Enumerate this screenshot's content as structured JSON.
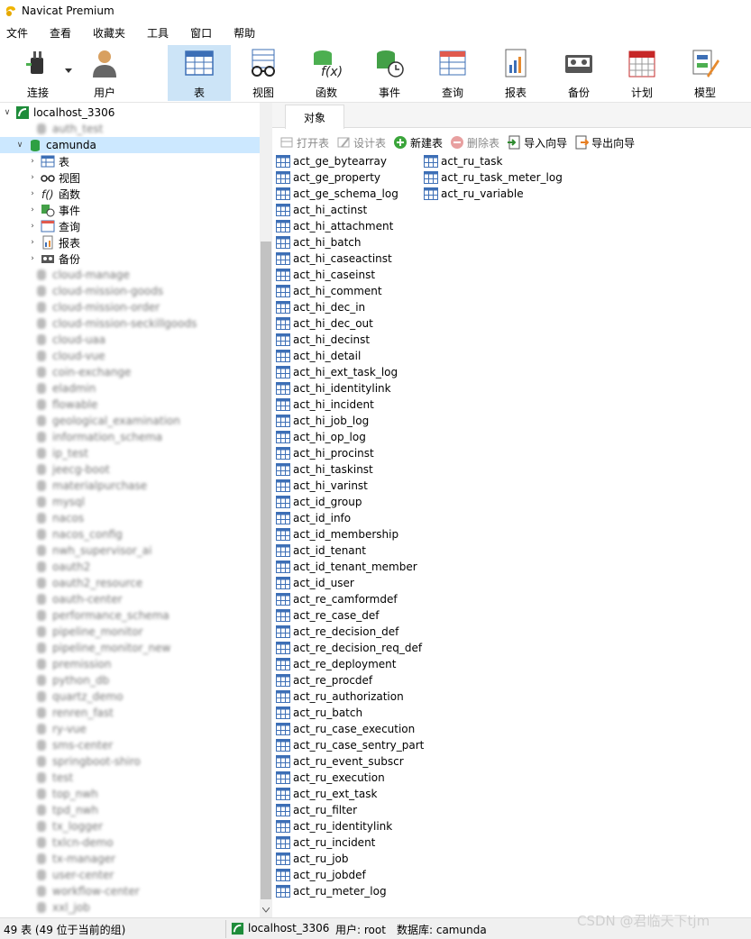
{
  "window": {
    "title": "Navicat Premium"
  },
  "menu": [
    "文件",
    "查看",
    "收藏夹",
    "工具",
    "窗口",
    "帮助"
  ],
  "toolbar": {
    "connect": "连接",
    "user": "用户",
    "table": "表",
    "view": "视图",
    "function": "函数",
    "event": "事件",
    "query": "查询",
    "report": "报表",
    "backup": "备份",
    "schedule": "计划",
    "model": "模型"
  },
  "tree": {
    "connection": "localhost_3306",
    "partial_db": "auth_test",
    "open_db": "camunda",
    "db_children": [
      "表",
      "视图",
      "函数",
      "事件",
      "查询",
      "报表",
      "备份"
    ],
    "other_dbs": [
      "cloud-manage",
      "cloud-mission-goods",
      "cloud-mission-order",
      "cloud-mission-seckillgoods",
      "cloud-uaa",
      "cloud-vue",
      "coin-exchange",
      "eladmin",
      "flowable",
      "geological_examination",
      "information_schema",
      "ip_test",
      "jeecg-boot",
      "materialpurchase",
      "mysql",
      "nacos",
      "nacos_config",
      "nwh_supervisor_ai",
      "oauth2",
      "oauth2_resource",
      "oauth-center",
      "performance_schema",
      "pipeline_monitor",
      "pipeline_monitor_new",
      "premission",
      "python_db",
      "quartz_demo",
      "renren_fast",
      "ry-vue",
      "sms-center",
      "springboot-shiro",
      "test",
      "top_nwh",
      "tpd_nwh",
      "tx_logger",
      "txlcn-demo",
      "tx-manager",
      "user-center",
      "workflow-center",
      "xxl_job"
    ]
  },
  "tabs": {
    "objects": "对象"
  },
  "object_toolbar": {
    "open_table": "打开表",
    "design_table": "设计表",
    "new_table": "新建表",
    "delete_table": "删除表",
    "import_wizard": "导入向导",
    "export_wizard": "导出向导"
  },
  "tables": [
    "act_ge_bytearray",
    "act_ge_property",
    "act_ge_schema_log",
    "act_hi_actinst",
    "act_hi_attachment",
    "act_hi_batch",
    "act_hi_caseactinst",
    "act_hi_caseinst",
    "act_hi_comment",
    "act_hi_dec_in",
    "act_hi_dec_out",
    "act_hi_decinst",
    "act_hi_detail",
    "act_hi_ext_task_log",
    "act_hi_identitylink",
    "act_hi_incident",
    "act_hi_job_log",
    "act_hi_op_log",
    "act_hi_procinst",
    "act_hi_taskinst",
    "act_hi_varinst",
    "act_id_group",
    "act_id_info",
    "act_id_membership",
    "act_id_tenant",
    "act_id_tenant_member",
    "act_id_user",
    "act_re_camformdef",
    "act_re_case_def",
    "act_re_decision_def",
    "act_re_decision_req_def",
    "act_re_deployment",
    "act_re_procdef",
    "act_ru_authorization",
    "act_ru_batch",
    "act_ru_case_execution",
    "act_ru_case_sentry_part",
    "act_ru_event_subscr",
    "act_ru_execution",
    "act_ru_ext_task",
    "act_ru_filter",
    "act_ru_identitylink",
    "act_ru_incident",
    "act_ru_job",
    "act_ru_jobdef",
    "act_ru_meter_log",
    "act_ru_task",
    "act_ru_task_meter_log",
    "act_ru_variable"
  ],
  "status": {
    "count": "49 表 (49 位于当前的组)",
    "connection": "localhost_3306",
    "user": "用户: root",
    "database": "数据库: camunda"
  },
  "watermark": "CSDN @君临天下tjm",
  "colors": {
    "selection": "#cce8ff",
    "toolbar_active": "#cce4f7",
    "db_icon": "#2ea043",
    "connection_icon": "#1e8c3a"
  }
}
